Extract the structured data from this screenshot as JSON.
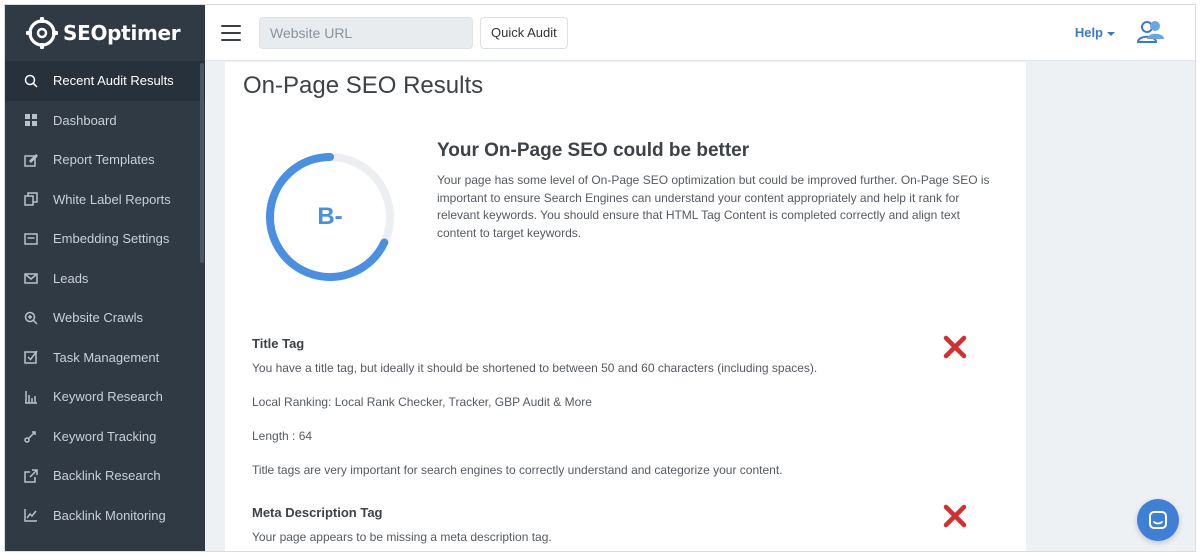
{
  "app": {
    "logo_text": "SEOptimer"
  },
  "topbar": {
    "url_placeholder": "Website URL",
    "quick_audit_label": "Quick Audit",
    "help_label": "Help"
  },
  "sidebar": {
    "items": [
      {
        "label": "Recent Audit Results",
        "icon": "search-icon"
      },
      {
        "label": "Dashboard",
        "icon": "dashboard-icon"
      },
      {
        "label": "Report Templates",
        "icon": "edit-icon"
      },
      {
        "label": "White Label Reports",
        "icon": "copy-icon"
      },
      {
        "label": "Embedding Settings",
        "icon": "embed-icon"
      },
      {
        "label": "Leads",
        "icon": "mail-icon"
      },
      {
        "label": "Website Crawls",
        "icon": "zoom-icon"
      },
      {
        "label": "Task Management",
        "icon": "checkbox-icon"
      },
      {
        "label": "Keyword Research",
        "icon": "bar-chart-icon"
      },
      {
        "label": "Keyword Tracking",
        "icon": "tracking-icon"
      },
      {
        "label": "Backlink Research",
        "icon": "external-link-icon"
      },
      {
        "label": "Backlink Monitoring",
        "icon": "line-chart-icon"
      }
    ]
  },
  "main": {
    "page_title": "On-Page SEO Results",
    "grade": "B-",
    "score_fraction": 0.68,
    "summary_title": "Your On-Page SEO could be better",
    "summary_lines": [
      "Your page has some level of On-Page SEO optimization but could be improved further. On-Page SEO is",
      "important to ensure Search Engines can understand your content appropriately and help it rank for",
      "relevant keywords. You should ensure that HTML Tag Content is completed correctly and align text",
      "content to target keywords."
    ],
    "title_tag": {
      "title": "Title Tag",
      "line1": "You have a title tag, but ideally it should be shortened to between 50 and 60 characters (including spaces).",
      "line2": "Local Ranking: Local Rank Checker, Tracker, GBP Audit & More",
      "line3": "Length : 64",
      "line4": "Title tags are very important for search engines to correctly understand and categorize your content."
    },
    "meta_tag": {
      "title": "Meta Description Tag",
      "line1": "Your page appears to be missing a meta description tag."
    }
  },
  "colors": {
    "sidebar_bg": "#2f3a45",
    "accent": "#4a90e2",
    "fail": "#d32f2f"
  }
}
